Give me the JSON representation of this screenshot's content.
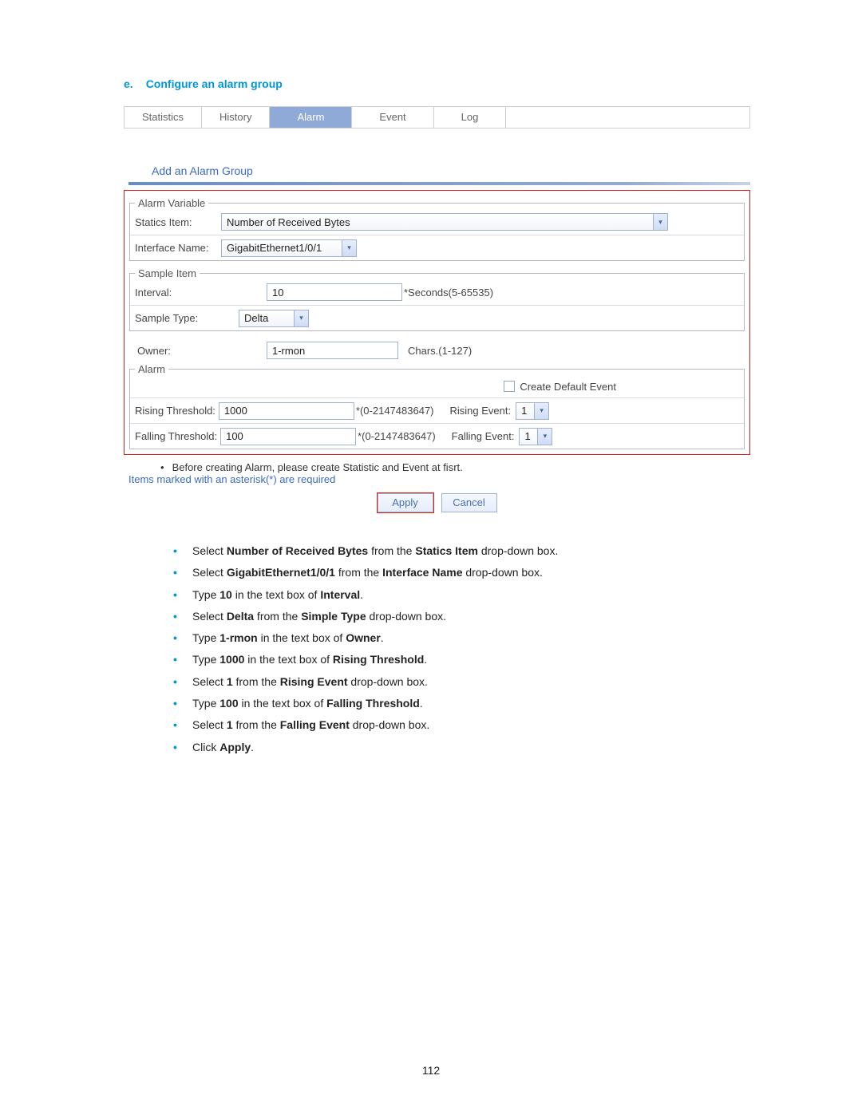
{
  "heading": {
    "marker": "e.",
    "title": "Configure an alarm group"
  },
  "tabs": {
    "statistics": "Statistics",
    "history": "History",
    "alarm": "Alarm",
    "event": "Event",
    "log": "Log"
  },
  "addTitle": "Add an Alarm Group",
  "alarmVariable": {
    "legend": "Alarm Variable",
    "staticsItemLabel": "Statics Item:",
    "staticsItemValue": "Number of Received Bytes",
    "interfaceLabel": "Interface Name:",
    "interfaceValue": "GigabitEthernet1/0/1"
  },
  "sampleItem": {
    "legend": "Sample Item",
    "intervalLabel": "Interval:",
    "intervalValue": "10",
    "intervalHint": "*Seconds(5-65535)",
    "sampleTypeLabel": "Sample Type:",
    "sampleTypeValue": "Delta"
  },
  "ownerRow": {
    "label": "Owner:",
    "value": "1-rmon",
    "hint": "Chars.(1-127)"
  },
  "alarm": {
    "legend": "Alarm",
    "createDefault": "Create Default Event",
    "risingThresholdLabel": "Rising Threshold:",
    "risingThresholdValue": "1000",
    "rangeHint": "*(0-2147483647)",
    "risingEventLabel": "Rising Event:",
    "risingEventValue": "1",
    "fallingThresholdLabel": "Falling Threshold:",
    "fallingThresholdValue": "100",
    "fallingEventLabel": "Falling Event:",
    "fallingEventValue": "1"
  },
  "notes": {
    "bullet": "Before creating Alarm, please create Statistic and Event at fisrt.",
    "req": "Items marked with an asterisk(*) are required"
  },
  "buttons": {
    "apply": "Apply",
    "cancel": "Cancel"
  },
  "instructions": {
    "i1a": "Select ",
    "i1b": "Number of Received Bytes",
    "i1c": " from the ",
    "i1d": "Statics Item",
    "i1e": " drop-down box.",
    "i2a": "Select ",
    "i2b": "GigabitEthernet1/0/1",
    "i2c": " from the ",
    "i2d": "Interface Name",
    "i2e": " drop-down box.",
    "i3a": "Type ",
    "i3b": "10",
    "i3c": " in the text box of ",
    "i3d": "Interval",
    "i3e": ".",
    "i4a": "Select ",
    "i4b": "Delta",
    "i4c": " from the ",
    "i4d": "Simple Type",
    "i4e": " drop-down box.",
    "i5a": "Type ",
    "i5b": "1-rmon",
    "i5c": " in the text box of ",
    "i5d": "Owner",
    "i5e": ".",
    "i6a": "Type ",
    "i6b": "1000",
    "i6c": " in the text box of ",
    "i6d": "Rising Threshold",
    "i6e": ".",
    "i7a": "Select ",
    "i7b": "1",
    "i7c": " from the ",
    "i7d": "Rising Event",
    "i7e": " drop-down box.",
    "i8a": "Type ",
    "i8b": "100",
    "i8c": " in the text box of ",
    "i8d": "Falling Threshold",
    "i8e": ".",
    "i9a": "Select ",
    "i9b": "1",
    "i9c": " from the ",
    "i9d": "Falling Event",
    "i9e": " drop-down box.",
    "i10a": "Click ",
    "i10b": "Apply",
    "i10c": "."
  },
  "pageNumber": "112"
}
